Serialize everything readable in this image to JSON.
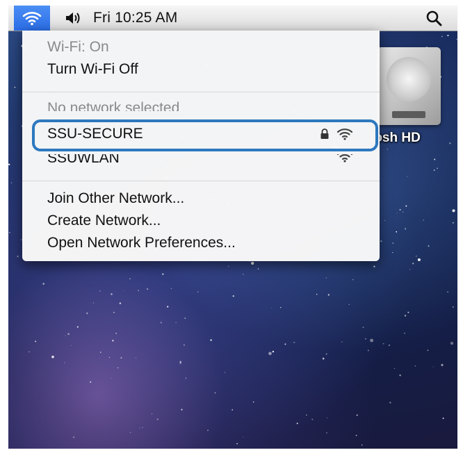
{
  "menubar": {
    "clock": "Fri 10:25 AM"
  },
  "desktop": {
    "drive_label": "tosh HD"
  },
  "wifi_menu": {
    "status": "Wi-Fi: On",
    "toggle": "Turn Wi-Fi Off",
    "no_network": "No network selected",
    "networks": [
      {
        "name": "SSU-SECURE",
        "secured": true
      },
      {
        "name": "SSUWLAN",
        "secured": false
      }
    ],
    "join_other": "Join Other Network...",
    "create": "Create Network...",
    "open_prefs": "Open Network Preferences..."
  },
  "colors": {
    "highlight_border": "#2d78bf",
    "wifi_active_bg": "#3a7df0"
  }
}
